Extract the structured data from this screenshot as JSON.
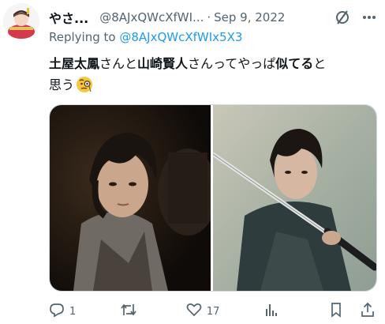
{
  "tweet": {
    "display_name": "やさ...",
    "handle": "@8AJxQWcXfWI...",
    "separator": "·",
    "date": "Sep 9, 2022",
    "replying_prefix": "Replying to",
    "replying_handle": "@8AJxQWcXfWIx5X3",
    "text_parts": {
      "name1": "土屋太鳳",
      "t1": "さんと",
      "name2": "山崎賢人",
      "t2": "さんってやっぱ",
      "bold": "似てる",
      "t3": "と",
      "t4": "思う"
    },
    "emoji": "face-with-monocle"
  },
  "actions": {
    "reply_count": "1",
    "retweet_count": "",
    "like_count": "17",
    "views_count": ""
  },
  "colors": {
    "link": "#1d9bf0",
    "muted": "#536471",
    "text": "#0f1419"
  },
  "icons": [
    "grok-slash-icon",
    "more-icon",
    "reply-icon",
    "retweet-icon",
    "like-icon",
    "views-icon",
    "bookmark-icon",
    "share-icon"
  ]
}
